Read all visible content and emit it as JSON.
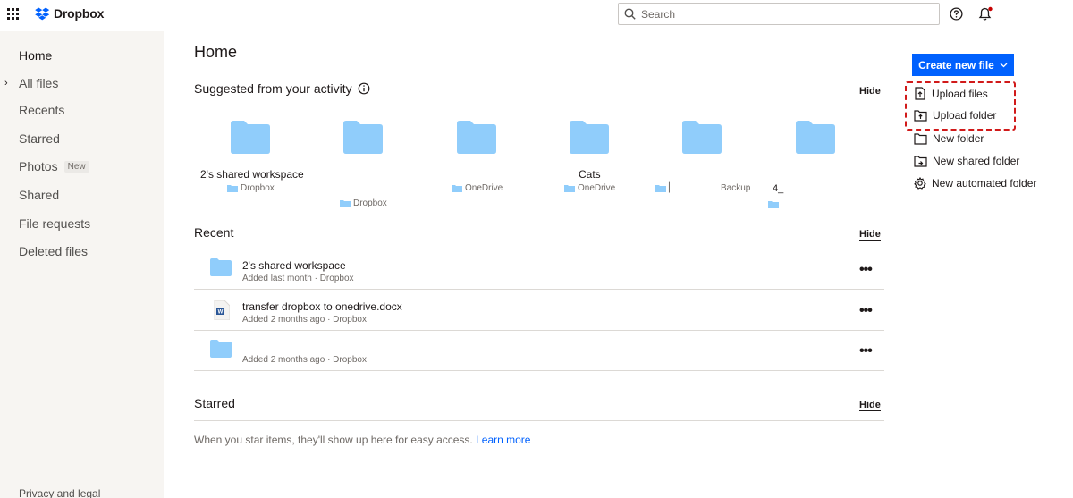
{
  "app": {
    "logo_text": "Dropbox"
  },
  "search": {
    "placeholder": "Search"
  },
  "sidebar": {
    "items": [
      {
        "label": "Home"
      },
      {
        "label": "All files"
      },
      {
        "label": "Recents"
      },
      {
        "label": "Starred"
      },
      {
        "label": "Photos",
        "badge": "New"
      },
      {
        "label": "Shared"
      },
      {
        "label": "File requests"
      },
      {
        "label": "Deleted files"
      }
    ],
    "footer": "Privacy and legal"
  },
  "main": {
    "title": "Home",
    "suggested": {
      "title": "Suggested from your activity",
      "hide": "Hide",
      "items": [
        {
          "name": "2's shared workspace",
          "location": "Dropbox"
        },
        {
          "name": "",
          "location": "Dropbox"
        },
        {
          "name": "",
          "location": "OneDrive"
        },
        {
          "name": "Cats",
          "location": "OneDrive"
        },
        {
          "name": "",
          "location": "▏"
        },
        {
          "name": "",
          "location": "Backup"
        },
        {
          "name": "",
          "location": "4_"
        }
      ]
    },
    "recent": {
      "title": "Recent",
      "hide": "Hide",
      "rows": [
        {
          "name": "2's shared workspace",
          "meta": "Added last month · Dropbox",
          "icon": "folder-icon"
        },
        {
          "name": "transfer dropbox to onedrive.docx",
          "meta": "Added 2 months ago · Dropbox",
          "icon": "word-doc-icon"
        },
        {
          "name": "",
          "meta": "Added 2 months ago · Dropbox",
          "icon": "folder-icon"
        }
      ],
      "more": "•••"
    },
    "starred": {
      "title": "Starred",
      "hide": "Hide",
      "empty_text": "When you star items, they'll show up here for easy access.",
      "learn_more": "Learn more"
    }
  },
  "actions": {
    "create_new_file": "Create new file",
    "items": [
      {
        "label": "Upload files",
        "icon": "upload-file-icon"
      },
      {
        "label": "Upload folder",
        "icon": "upload-folder-icon"
      },
      {
        "label": "New folder",
        "icon": "folder-outline-icon"
      },
      {
        "label": "New shared folder",
        "icon": "shared-folder-icon"
      },
      {
        "label": "New automated folder",
        "icon": "gear-icon"
      }
    ]
  },
  "colors": {
    "accent": "#0061fe",
    "folder": "#90cdfb",
    "sidebar_bg": "#f7f5f2",
    "highlight": "#d11a1a"
  }
}
